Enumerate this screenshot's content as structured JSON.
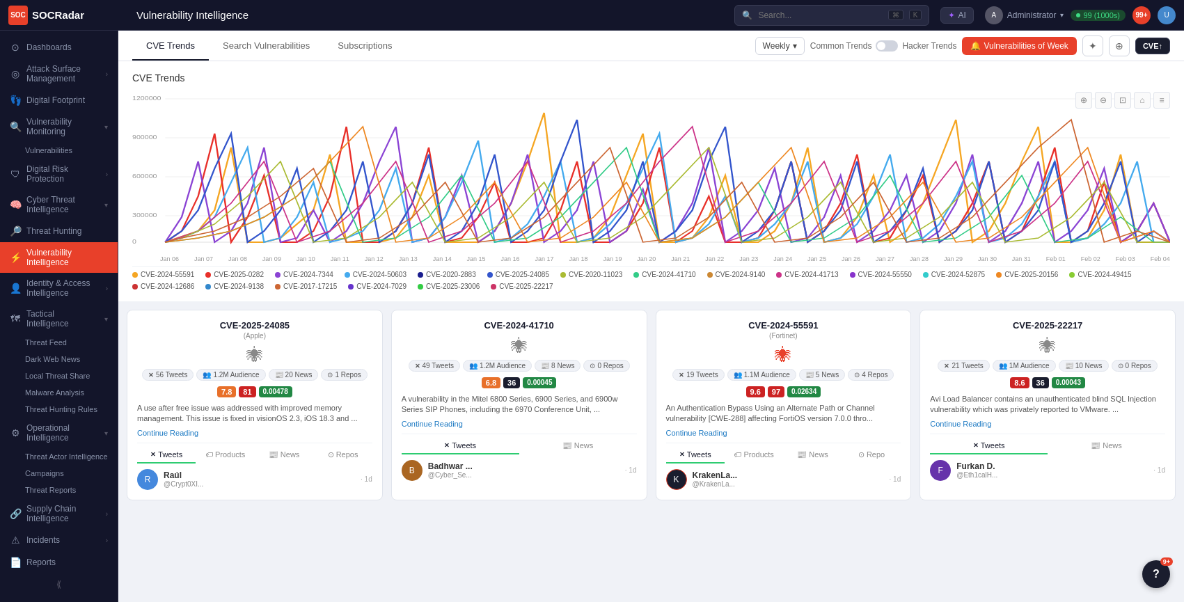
{
  "topbar": {
    "logo_text": "SOCRadar",
    "page_title": "Vulnerability Intelligence",
    "search_placeholder": "Search...",
    "ai_label": "AI",
    "user_name": "Administrator",
    "green_status": "99 (1000s)",
    "notif_count": "99+"
  },
  "sidebar": {
    "items": [
      {
        "id": "dashboards",
        "label": "Dashboards",
        "icon": "⊙",
        "has_children": false
      },
      {
        "id": "attack-surface",
        "label": "Attack Surface Management",
        "icon": "◎",
        "has_children": true
      },
      {
        "id": "digital-footprint",
        "label": "Digital Footprint",
        "icon": "👣",
        "has_children": false
      },
      {
        "id": "vuln-monitoring",
        "label": "Vulnerability Monitoring",
        "icon": "🔍",
        "has_children": true
      },
      {
        "id": "vulnerabilities",
        "label": "Vulnerabilities",
        "icon": "",
        "is_sub": true
      },
      {
        "id": "digital-risk",
        "label": "Digital Risk Protection",
        "icon": "🛡",
        "has_children": true
      },
      {
        "id": "cyber-threat",
        "label": "Cyber Threat Intelligence",
        "icon": "🧠",
        "has_children": true
      },
      {
        "id": "threat-hunting",
        "label": "Threat Hunting",
        "icon": "🔎",
        "has_children": false
      },
      {
        "id": "vuln-intelligence",
        "label": "Vulnerability Intelligence",
        "icon": "⚡",
        "has_children": false,
        "active": true
      },
      {
        "id": "identity-access",
        "label": "Identity & Access Intelligence",
        "icon": "👤",
        "has_children": true
      },
      {
        "id": "tactical-intel",
        "label": "Tactical Intelligence",
        "icon": "🗺",
        "has_children": true
      },
      {
        "id": "threat-feed",
        "label": "Threat Feed",
        "icon": "",
        "is_sub": true
      },
      {
        "id": "dark-web",
        "label": "Dark Web News",
        "icon": "",
        "is_sub": true
      },
      {
        "id": "local-threat",
        "label": "Local Threat Share",
        "icon": "",
        "is_sub": true
      },
      {
        "id": "malware-analysis",
        "label": "Malware Analysis",
        "icon": "",
        "is_sub": true
      },
      {
        "id": "threat-hunting-rules",
        "label": "Threat Hunting Rules",
        "icon": "",
        "is_sub": true
      },
      {
        "id": "operational-intel",
        "label": "Operational Intelligence",
        "icon": "⚙",
        "has_children": true
      },
      {
        "id": "threat-actor",
        "label": "Threat Actor Intelligence",
        "icon": "",
        "is_sub": true
      },
      {
        "id": "campaigns",
        "label": "Campaigns",
        "icon": "",
        "is_sub": true
      },
      {
        "id": "threat-reports",
        "label": "Threat Reports",
        "icon": "",
        "is_sub": true
      },
      {
        "id": "supply-chain",
        "label": "Supply Chain Intelligence",
        "icon": "🔗",
        "has_children": true
      },
      {
        "id": "incidents",
        "label": "Incidents",
        "icon": "⚠",
        "has_children": true
      },
      {
        "id": "reports",
        "label": "Reports",
        "icon": "📄",
        "has_children": false
      }
    ]
  },
  "tabs": {
    "items": [
      {
        "id": "cve-trends",
        "label": "CVE Trends",
        "active": true
      },
      {
        "id": "search-vuln",
        "label": "Search Vulnerabilities",
        "active": false
      },
      {
        "id": "subscriptions",
        "label": "Subscriptions",
        "active": false
      }
    ],
    "period": "Weekly",
    "toggle_label1": "Common Trends",
    "toggle_label2": "Hacker Trends",
    "vuln_week_label": "Vulnerabilities of Week",
    "cve_label": "CVE↑"
  },
  "chart": {
    "title": "CVE Trends",
    "y_labels": [
      "1200000",
      "900000",
      "600000",
      "300000",
      "0"
    ],
    "x_labels": [
      "Jan 06",
      "Jan 07",
      "Jan 08",
      "Jan 09",
      "Jan 10",
      "Jan 11",
      "Jan 12",
      "Jan 13",
      "Jan 14",
      "Jan 15",
      "Jan 16",
      "Jan 17",
      "Jan 18",
      "Jan 19",
      "Jan 20",
      "Jan 21",
      "Jan 22",
      "Jan 23",
      "Jan 24",
      "Jan 25",
      "Jan 26",
      "Jan 27",
      "Jan 28",
      "Jan 29",
      "Jan 30",
      "Jan 31",
      "Feb 01",
      "Feb 02",
      "Feb 03",
      "Feb 04"
    ],
    "legend": [
      {
        "id": "cve1",
        "label": "CVE-2024-55591",
        "color": "#f5a623"
      },
      {
        "id": "cve2",
        "label": "CVE-2025-0282",
        "color": "#e8302a"
      },
      {
        "id": "cve3",
        "label": "CVE-2024-7344",
        "color": "#8b44d4"
      },
      {
        "id": "cve4",
        "label": "CVE-2024-50603",
        "color": "#44aaee"
      },
      {
        "id": "cve5",
        "label": "CVE-2020-2883",
        "color": "#1a1d8e"
      },
      {
        "id": "cve6",
        "label": "CVE-2025-24085",
        "color": "#3355cc"
      },
      {
        "id": "cve7",
        "label": "CVE-2020-11023",
        "color": "#aabb33"
      },
      {
        "id": "cve8",
        "label": "CVE-2024-41710",
        "color": "#33cc88"
      },
      {
        "id": "cve9",
        "label": "CVE-2024-9140",
        "color": "#cc8833"
      },
      {
        "id": "cve10",
        "label": "CVE-2024-41713",
        "color": "#cc3388"
      },
      {
        "id": "cve11",
        "label": "CVE-2024-55550",
        "color": "#8833cc"
      },
      {
        "id": "cve12",
        "label": "CVE-2024-52875",
        "color": "#33cccc"
      },
      {
        "id": "cve13",
        "label": "CVE-2025-20156",
        "color": "#ee8822"
      },
      {
        "id": "cve14",
        "label": "CVE-2024-49415",
        "color": "#88cc33"
      },
      {
        "id": "cve15",
        "label": "CVE-2024-12686",
        "color": "#cc3333"
      },
      {
        "id": "cve16",
        "label": "CVE-2024-9138",
        "color": "#3388cc"
      },
      {
        "id": "cve17",
        "label": "CVE-2017-17215",
        "color": "#cc6633"
      },
      {
        "id": "cve18",
        "label": "CVE-2024-7029",
        "color": "#6633cc"
      },
      {
        "id": "cve19",
        "label": "CVE-2025-23006",
        "color": "#33cc44"
      },
      {
        "id": "cve20",
        "label": "CVE-2025-22217",
        "color": "#cc3366"
      }
    ]
  },
  "cards": [
    {
      "id": "card1",
      "cve_id": "CVE-2025-24085",
      "vendor": "(Apple)",
      "tweets": "56 Tweets",
      "audience": "1.2M Audience",
      "news": "20 News",
      "repos": "1 Repos",
      "score1": "7.8",
      "score2": "81",
      "score3": "0.00478",
      "score1_color": "orange",
      "score2_color": "red",
      "description": "A use after free issue was addressed with improved memory management. This issue is fixed in visionOS 2.3, iOS 18.3 and ...",
      "continue_reading": "Continue Reading",
      "tabs": [
        "Tweets",
        "Products",
        "News",
        "Repos"
      ],
      "active_tab": "Tweets",
      "user": {
        "name": "Raúl",
        "handle": "@Crypt0XI...",
        "time": "1d",
        "color": "#4488dd"
      }
    },
    {
      "id": "card2",
      "cve_id": "CVE-2024-41710",
      "vendor": "",
      "tweets": "49 Tweets",
      "audience": "1.2M Audience",
      "news": "8 News",
      "repos": "0 Repos",
      "score1": "6.8",
      "score2": "36",
      "score3": "0.00045",
      "score1_color": "orange",
      "score2_color": "dark",
      "description": "A vulnerability in the Mitel 6800 Series, 6900 Series, and 6900w Series SIP Phones, including the 6970 Conference Unit, ...",
      "continue_reading": "Continue Reading",
      "tabs": [
        "Tweets",
        "News"
      ],
      "active_tab": "Tweets",
      "user": {
        "name": "Badhwar ...",
        "handle": "@Cyber_Se...",
        "time": "1d",
        "color": "#aa6622"
      }
    },
    {
      "id": "card3",
      "cve_id": "CVE-2024-55591",
      "vendor": "(Fortinet)",
      "tweets": "19 Tweets",
      "audience": "1.1M Audience",
      "news": "5 News",
      "repos": "4 Repos",
      "score1": "9.6",
      "score2": "97",
      "score3": "0.02634",
      "score1_color": "red",
      "score2_color": "red",
      "description": "An Authentication Bypass Using an Alternate Path or Channel vulnerability [CWE-288] affecting FortiOS version 7.0.0 thro...",
      "continue_reading": "Continue Reading",
      "tabs": [
        "Tweets",
        "Products",
        "News",
        "Repo"
      ],
      "active_tab": "Tweets",
      "user": {
        "name": "KrakenLa...",
        "handle": "@KrakenLa...",
        "time": "1d",
        "color": "#cc2222"
      }
    },
    {
      "id": "card4",
      "cve_id": "CVE-2025-22217",
      "vendor": "",
      "tweets": "21 Tweets",
      "audience": "1M Audience",
      "news": "10 News",
      "repos": "0 Repos",
      "score1": "8.6",
      "score2": "36",
      "score3": "0.00043",
      "score1_color": "red",
      "score2_color": "dark",
      "description": "Avi Load Balancer contains an unauthenticated blind SQL Injection vulnerability which was privately reported to VMware. ...",
      "continue_reading": "Continue Reading",
      "tabs": [
        "Tweets",
        "News"
      ],
      "active_tab": "Tweets",
      "user": {
        "name": "Furkan D.",
        "handle": "@Eth1calH...",
        "time": "1d",
        "color": "#6633aa"
      }
    }
  ],
  "icons": {
    "search": "🔍",
    "bell": "🔔",
    "star": "★",
    "chevron_down": "▾",
    "chevron_right": "›",
    "bug": "🕷",
    "x_logo": "✕",
    "people": "👥",
    "newspaper": "📰",
    "github": "⊙",
    "zoom_in": "⊕",
    "zoom_out": "⊖",
    "zoom_fit": "⊡",
    "home": "⌂",
    "menu": "≡"
  }
}
